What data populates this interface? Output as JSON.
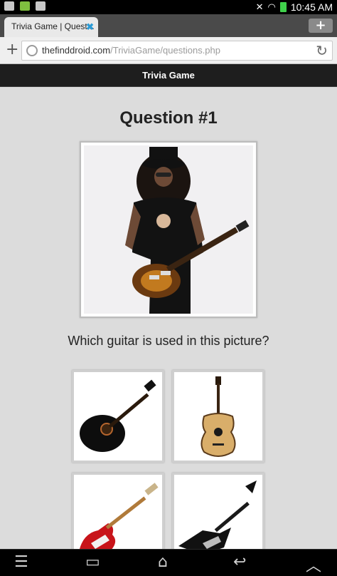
{
  "status_bar": {
    "time": "10:45 AM",
    "icons": [
      "gallery-icon",
      "android-icon",
      "media-icon",
      "mute-icon",
      "wifi-icon",
      "battery-icon"
    ]
  },
  "browser": {
    "tab_title": "Trivia Game | Quest...",
    "url_host": "thefinddroid.com",
    "url_path": "/TriviaGame/questions.php"
  },
  "page": {
    "header_title": "Trivia Game",
    "question_title": "Question #1",
    "question_text": "Which guitar is used in this picture?",
    "options": [
      {
        "name": "black acoustic-electric cutaway guitar"
      },
      {
        "name": "natural acoustic dreadnought guitar"
      },
      {
        "name": "red stratocaster guitar"
      },
      {
        "name": "black explorer-style guitar"
      }
    ]
  },
  "nav_bar": {
    "buttons": [
      "menu-icon",
      "recent-apps-icon",
      "home-icon",
      "back-icon",
      "up-icon"
    ]
  },
  "colors": {
    "content_bg": "#dcdcdc",
    "header_bg": "#1e1e1e",
    "tab_close": "#2b9bd6",
    "battery": "#3fd14b"
  }
}
